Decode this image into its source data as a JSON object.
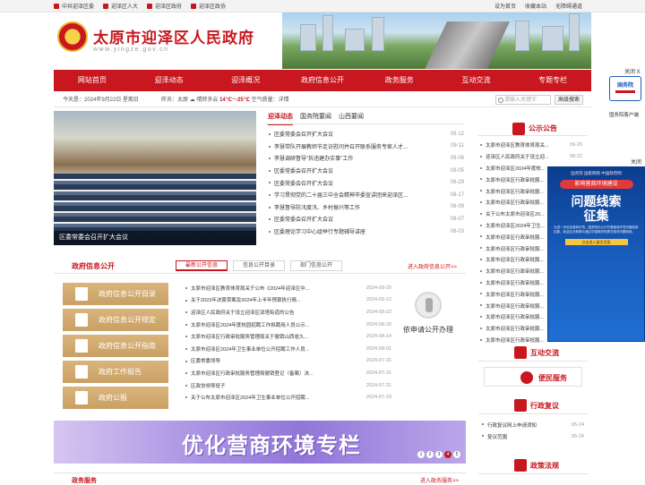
{
  "topbar": {
    "links": [
      "中共迎泽区委",
      "迎泽区人大",
      "迎泽区政府",
      "迎泽区政协"
    ],
    "right": [
      "设为首页",
      "收藏本站",
      "无障碍通道"
    ]
  },
  "header": {
    "site_name": "太原市迎泽区人民政府",
    "site_url": "www.yingze.gov.cn"
  },
  "nav": [
    "网站首页",
    "迎泽动态",
    "迎泽概况",
    "政府信息公开",
    "政务服务",
    "互动交流",
    "专题专栏"
  ],
  "infobar": {
    "date": "今天是：2024年9月22日 星期日",
    "weather_day": "昨天：",
    "weather_city": "太原",
    "weather_desc": "晴转多云",
    "temp_low": "14℃",
    "temp_sep": "～",
    "temp_high": "25℃",
    "air": "空气质量：",
    "air_value": "详情"
  },
  "search": {
    "placeholder": "请输入关键字",
    "button": "高级搜索"
  },
  "slide": {
    "caption": "区委常委会召开扩大会议"
  },
  "news": {
    "tabs": [
      "迎泽动态",
      "国务院要闻",
      "山西要闻"
    ],
    "items": [
      {
        "title": "区委常委会召开扩大会议",
        "date": "09-12"
      },
      {
        "title": "李慧带队开展教师节走访慰问并召开联系服务专家人才...",
        "date": "09-11"
      },
      {
        "title": "李慧调研督导\"拆违建办实事\"工作",
        "date": "09-06"
      },
      {
        "title": "区委常委会召开扩大会议",
        "date": "09-05"
      },
      {
        "title": "区委常委会召开扩大会议",
        "date": "08-29"
      },
      {
        "title": "学习贯彻党的二十届三中全会精神市委宣讲团来迎泽区...",
        "date": "08-17"
      },
      {
        "title": "李慧督导防汛度汛、乡村振兴等工作",
        "date": "08-09"
      },
      {
        "title": "区委常委会召开扩大会议",
        "date": "08-07"
      },
      {
        "title": "区委理论学习中心组举行专题辅导讲座",
        "date": "08-03"
      }
    ]
  },
  "notices": {
    "title": "公示公告",
    "items": [
      {
        "title": "太原市迎泽区教育体育局关...",
        "date": "09-20"
      },
      {
        "title": "迎泽区人民政府关于设立迎...",
        "date": "08-22"
      },
      {
        "title": "太原市迎泽区2024年度校...",
        "date": ""
      },
      {
        "title": "太原市迎泽区行政审批服...",
        "date": ""
      },
      {
        "title": "太原市迎泽区行政审批服...",
        "date": ""
      },
      {
        "title": "太原市迎泽区行政审批服...",
        "date": ""
      },
      {
        "title": "关于公布太原市迎泽区20...",
        "date": ""
      },
      {
        "title": "太原市迎泽区2024年卫生...",
        "date": ""
      },
      {
        "title": "太原市迎泽区行政审批服...",
        "date": ""
      },
      {
        "title": "太原市迎泽区行政审批服...",
        "date": ""
      },
      {
        "title": "太原市迎泽区行政审批服...",
        "date": ""
      },
      {
        "title": "太原市迎泽区行政审批服...",
        "date": ""
      },
      {
        "title": "太原市迎泽区行政审批服...",
        "date": ""
      },
      {
        "title": "太原市迎泽区行政审批服...",
        "date": ""
      },
      {
        "title": "太原市迎泽区行政审批服...",
        "date": ""
      },
      {
        "title": "太原市迎泽区行政审批服...",
        "date": ""
      },
      {
        "title": "太原市迎泽区行政审批服...",
        "date": ""
      },
      {
        "title": "太原市迎泽区行政审批服...",
        "date": ""
      }
    ]
  },
  "float_ad": {
    "head": "国务院 国家网络 中国政府网",
    "tag": "影响营商环境建设",
    "line1": "问题线索",
    "line2": "征集",
    "body": "为进一步优化营商环境，国务院办公厅开展营商环境问题线索征集，欢迎企业和群众通过中国政府网提交相关问题线索。",
    "button": "点击进入留言页面"
  },
  "gov_logo": {
    "label": "国务院",
    "sub": "国务院客户端",
    "close": "关闭 X",
    "close2": "关闭"
  },
  "xxgk": {
    "title": "政府信息公开",
    "tabs": [
      "最新公开信息",
      "信息公开目录",
      "部门信息公开"
    ],
    "more": "进入政府信息公开>>",
    "buttons": [
      "政府信息公开目录",
      "政府信息公开规定",
      "政府信息公开指南",
      "政府工作报告",
      "政府公报"
    ],
    "items": [
      {
        "title": "太原市迎泽区教育体育局关于公布《2024年迎泽区中...",
        "date": "2024-09-20"
      },
      {
        "title": "关于2023年决算草案及2024年上半年预算执行情...",
        "date": "2024-09-12"
      },
      {
        "title": "迎泽区人民政府关于设立迎泽区双塔街道的公告",
        "date": "2024-08-22"
      },
      {
        "title": "太原市迎泽区2024年度校园招聘工作拟聘用人员公示...",
        "date": "2024-08-20"
      },
      {
        "title": "太原市迎泽区行政审批服务管理局关于撤销山西省久...",
        "date": "2024-08-14"
      },
      {
        "title": "太原市迎泽区2024年卫生事业单位公开招聘工作人员...",
        "date": "2024-08-01"
      },
      {
        "title": "区委常委领导",
        "date": "2024-07-31"
      },
      {
        "title": "太原市迎泽区行政审批服务管理局撤销登记（备案）决...",
        "date": "2024-07-31"
      },
      {
        "title": "区政协领导班子",
        "date": "2024-07-31"
      },
      {
        "title": "关于公布太原市迎泽区2024年卫生事业单位公开招聘...",
        "date": "2024-07-29"
      }
    ],
    "apply": "依申请公开办理"
  },
  "banner": {
    "text": "优化营商环境专栏",
    "pages": [
      "1",
      "2",
      "3",
      "4",
      "5"
    ]
  },
  "bottom": {
    "title": "政务服务",
    "more": "进入政务服务>>"
  },
  "right": {
    "interaction": "互动交流",
    "service": "便民服务",
    "review": "行政复议",
    "review_items": [
      {
        "title": "行政复议网上申请须知",
        "date": "05-24"
      },
      {
        "title": "复议范围",
        "date": "05-24"
      }
    ],
    "policy": "政策法规"
  }
}
